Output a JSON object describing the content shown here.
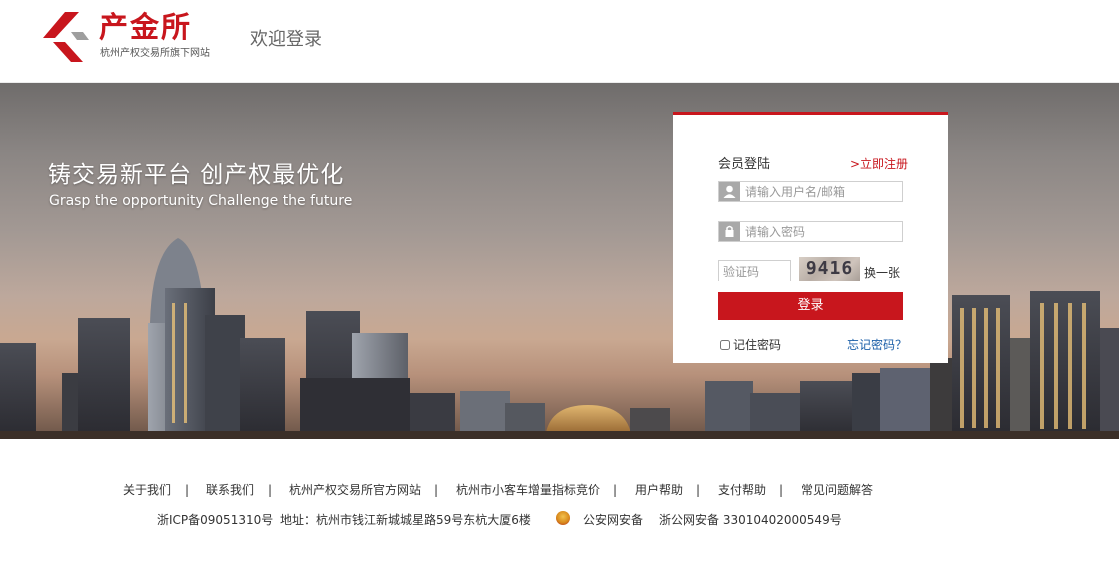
{
  "header": {
    "logo_name": "产金所",
    "logo_subtitle": "杭州产权交易所旗下网站",
    "welcome": "欢迎登录"
  },
  "banner": {
    "slogan_cn": "铸交易新平台 创产权最优化",
    "slogan_en": "Grasp the opportunity Challenge the future"
  },
  "login": {
    "title": "会员登陆",
    "register": ">立即注册",
    "username_placeholder": "请输入用户名/邮箱",
    "password_placeholder": "请输入密码",
    "captcha_placeholder": "验证码",
    "captcha_code": "9416",
    "refresh": "换一张",
    "submit": "登录",
    "remember": "记住密码",
    "forgot": "忘记密码？"
  },
  "footer": {
    "links": [
      "关于我们",
      "联系我们",
      "杭州产权交易所官方网站",
      "杭州市小客车增量指标竞价",
      "用户帮助",
      "支付帮助",
      "常见问题解答"
    ],
    "icp": "浙ICP备09051310号",
    "address": "地址：杭州市钱江新城城星路59号东杭大厦6楼",
    "police": "公安网安备",
    "police_number": "浙公网安备 33010402000549号"
  },
  "colors": {
    "brand_red": "#c8161d",
    "link_blue": "#1a5ea8"
  }
}
